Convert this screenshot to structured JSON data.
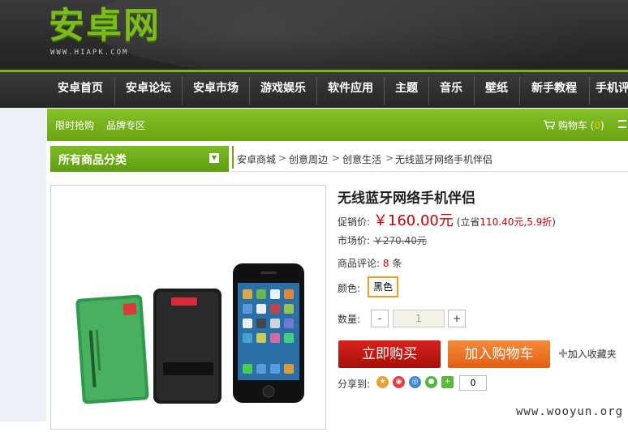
{
  "header": {
    "logo_text": "安卓网",
    "logo_url": "WWW.HIAPK.COM"
  },
  "nav": {
    "items": [
      "安卓首页",
      "安卓论坛",
      "安卓市场",
      "游戏娱乐",
      "软件应用",
      "主题",
      "音乐",
      "壁纸",
      "新手教程",
      "手机评"
    ]
  },
  "subnav": {
    "links": [
      "限时抢购",
      "品牌专区"
    ],
    "cart_label": "购物车",
    "cart_count": "0"
  },
  "category": {
    "title": "所有商品分类"
  },
  "breadcrumb": [
    "安卓商城",
    "创意周边",
    "创意生活",
    "无线蓝牙网络手机伴侣"
  ],
  "product": {
    "title": "无线蓝牙网络手机伴侣",
    "promo_label": "促销价:",
    "promo_price": "￥160.00元",
    "save_prefix": "(立省",
    "save_amount": "110.40元",
    "discount": "5.9折",
    "save_suffix": ")",
    "market_label": "市场价:",
    "market_price": "￥270.40元",
    "reviews_label": "商品评论:",
    "reviews_count": "8",
    "reviews_unit": "条",
    "color_label": "颜色:",
    "color_value": "黑色",
    "qty_label": "数量:",
    "qty_minus": "-",
    "qty_value": "1",
    "qty_plus": "+",
    "buy_now": "立即购买",
    "add_to_cart": "加入购物车",
    "add_favorite": "加入收藏夹",
    "share_label": "分享到:",
    "share_count": "0"
  },
  "watermark": "www.wooyun.org"
}
